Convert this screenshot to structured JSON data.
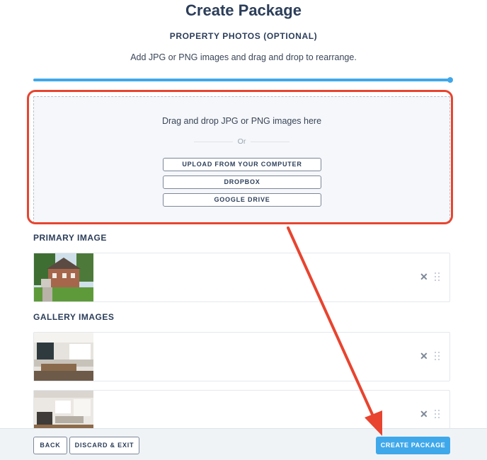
{
  "header": {
    "title": "Create Package",
    "subtitle": "PROPERTY PHOTOS (OPTIONAL)",
    "description": "Add JPG or PNG images and drag and drop to rearrange."
  },
  "progress": {
    "value": 1.0
  },
  "dropzone": {
    "prompt": "Drag and drop JPG or PNG images here",
    "or_label": "Or",
    "buttons": [
      "UPLOAD FROM YOUR COMPUTER",
      "DROPBOX",
      "GOOGLE DRIVE"
    ]
  },
  "primary": {
    "label": "PRIMARY IMAGE"
  },
  "gallery": {
    "label": "GALLERY IMAGES"
  },
  "footer": {
    "back_label": "BACK",
    "discard_label": "DISCARD & EXIT",
    "create_label": "CREATE PACKAGE"
  },
  "colors": {
    "accent": "#3fa8ea",
    "annotation": "#e8442f",
    "text": "#2c3e5a"
  },
  "icons": {
    "remove": "close-icon",
    "drag": "drag-handle-icon"
  }
}
